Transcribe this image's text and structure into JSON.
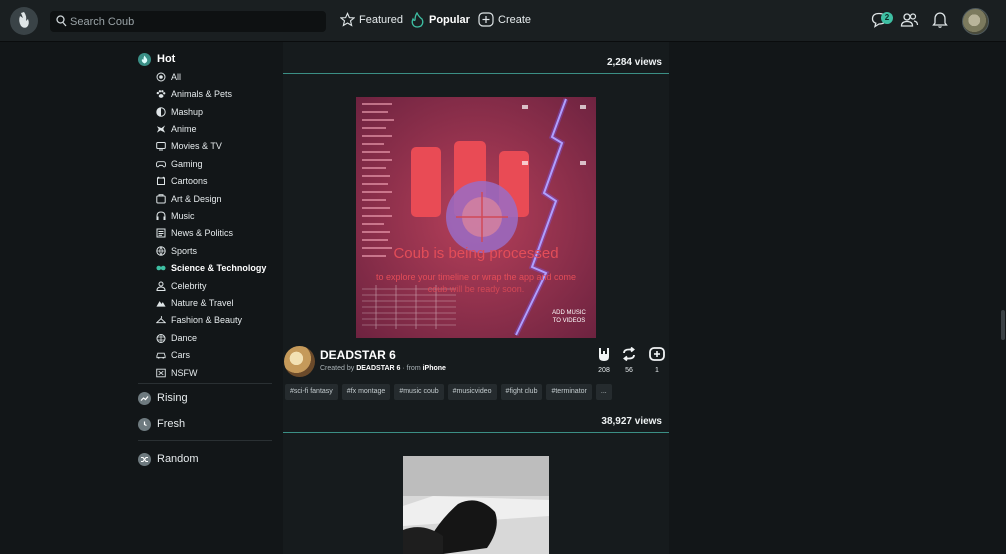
{
  "header": {
    "search_placeholder": "Search Coub",
    "nav": [
      {
        "label": "Featured",
        "icon": "star-icon"
      },
      {
        "label": "Popular",
        "icon": "flame-icon"
      },
      {
        "label": "Create",
        "icon": "plus-box-icon"
      }
    ],
    "notifications_badge": "2"
  },
  "sidebar": {
    "hot": "Hot",
    "categories": [
      "All",
      "Animals & Pets",
      "Mashup",
      "Anime",
      "Movies & TV",
      "Gaming",
      "Cartoons",
      "Art & Design",
      "Music",
      "News & Politics",
      "Sports",
      "Science & Technology",
      "Celebrity",
      "Nature & Travel",
      "Fashion & Beauty",
      "Dance",
      "Cars",
      "NSFW"
    ],
    "active_category": "Science & Technology",
    "rising": "Rising",
    "fresh": "Fresh",
    "random": "Random"
  },
  "feed": {
    "top_views": "2,284 views",
    "coub": {
      "processing_text": "Coub is being processed",
      "processing_sub1": "to explore your timeline or wrap the app and come",
      "processing_sub2": "coub will be ready soon.",
      "overlay_label1": "ADD MUSIC",
      "overlay_label2": "TO VIDEOS",
      "title": "DEADSTAR 6",
      "created_by_prefix": "Created by",
      "author": "DEADSTAR 6",
      "from_prefix": "· from",
      "source": "iPhone",
      "likes": "208",
      "recoubs": "56",
      "remixes": "1",
      "tags": [
        "#sci-fi fantasy",
        "#fx montage",
        "#music coub",
        "#musicvideo",
        "#fight club",
        "#terminator",
        "..."
      ]
    },
    "second_views": "38,927 views"
  }
}
